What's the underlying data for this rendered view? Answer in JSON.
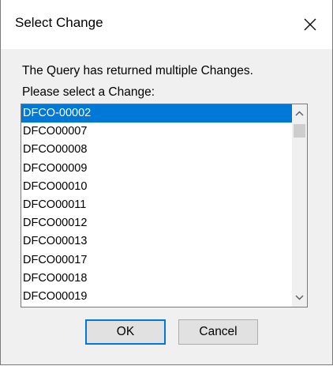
{
  "dialog": {
    "title": "Select Change",
    "message_line1": "The Query has returned multiple Changes.",
    "message_line2": "Please select a Change:"
  },
  "list": {
    "selected_index": 0,
    "items": [
      "DFCO-00002",
      "DFCO00007",
      "DFCO00008",
      "DFCO00009",
      "DFCO00010",
      "DFCO00011",
      "DFCO00012",
      "DFCO00013",
      "DFCO00017",
      "DFCO00018",
      "DFCO00019"
    ]
  },
  "buttons": {
    "ok_label": "OK",
    "cancel_label": "Cancel"
  },
  "colors": {
    "selection": "#0078d7",
    "dialog_bg": "#f0f0f0",
    "default_button_border": "#0078d7"
  },
  "icons": {
    "close": "close-icon",
    "scroll_up": "chevron-up-icon",
    "scroll_down": "chevron-down-icon"
  }
}
